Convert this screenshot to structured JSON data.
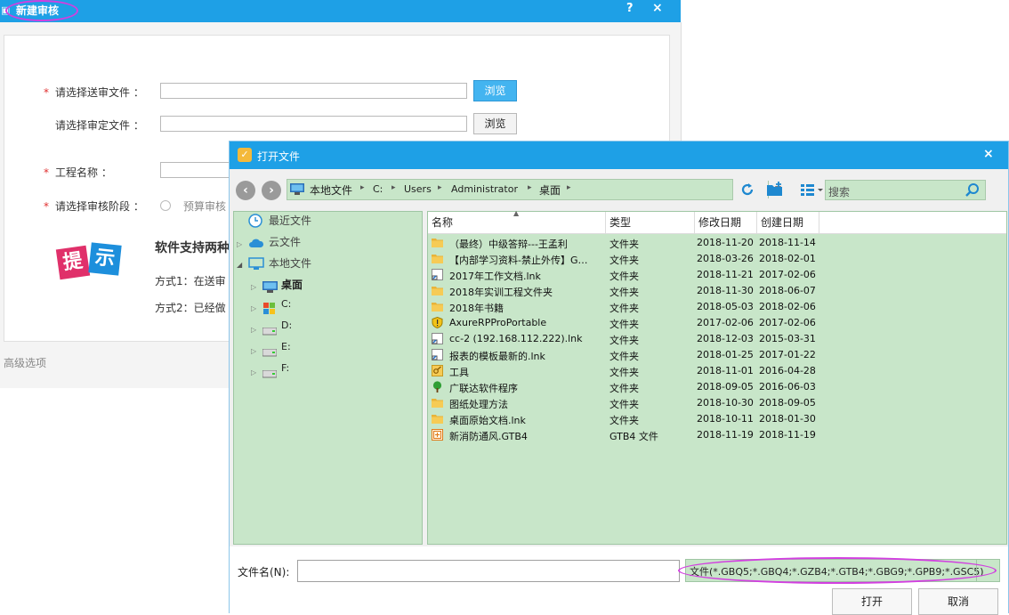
{
  "bg_window": {
    "title": "新建审核",
    "help": "?",
    "close": "×",
    "form": {
      "required_mark": "*",
      "send_file_label": "请选择送审文件 ：",
      "approve_file_label": "请选择审定文件 ：",
      "project_name_label": "工程名称 ：",
      "stage_label": "请选择审核阶段 ：",
      "stage_option": "预算审核",
      "browse_label": "浏览"
    },
    "tip": {
      "logo_chars": [
        "提",
        "示"
      ],
      "title": "软件支持两种",
      "way1": "方式1：在送审",
      "way2": "方式2：已经做"
    },
    "advanced": "高级选项"
  },
  "dialog": {
    "title": "打开文件",
    "icon": "✓",
    "close": "×",
    "breadcrumb": [
      "本地文件",
      "C:",
      "Users",
      "Administrator",
      "桌面"
    ],
    "search_placeholder": "搜索",
    "tree": {
      "recent": "最近文件",
      "cloud": "云文件",
      "local": "本地文件",
      "desktop": "桌面",
      "drives": [
        "C:",
        "D:",
        "E:",
        "F:"
      ]
    },
    "columns": [
      "名称",
      "类型",
      "修改日期",
      "创建日期"
    ],
    "rows": [
      {
        "name": "（最终）中级答辩---王孟利",
        "type": "文件夹",
        "modified": "2018-11-20",
        "created": "2018-11-14",
        "icon": "folder"
      },
      {
        "name": "【内部学习资料-禁止外传】G…",
        "type": "文件夹",
        "modified": "2018-03-26",
        "created": "2018-02-01",
        "icon": "folder"
      },
      {
        "name": "2017年工作文档.lnk",
        "type": "文件夹",
        "modified": "2018-11-21",
        "created": "2017-02-06",
        "icon": "shortcut"
      },
      {
        "name": "2018年实训工程文件夹",
        "type": "文件夹",
        "modified": "2018-11-30",
        "created": "2018-06-07",
        "icon": "folder"
      },
      {
        "name": "2018年书籍",
        "type": "文件夹",
        "modified": "2018-05-03",
        "created": "2018-02-06",
        "icon": "folder"
      },
      {
        "name": "AxureRPProPortable",
        "type": "文件夹",
        "modified": "2017-02-06",
        "created": "2017-02-06",
        "icon": "shield"
      },
      {
        "name": "cc-2 (192.168.112.222).lnk",
        "type": "文件夹",
        "modified": "2018-12-03",
        "created": "2015-03-31",
        "icon": "shortcut"
      },
      {
        "name": "报表的模板最新的.lnk",
        "type": "文件夹",
        "modified": "2018-01-25",
        "created": "2017-01-22",
        "icon": "shortcut"
      },
      {
        "name": "工具",
        "type": "文件夹",
        "modified": "2018-11-01",
        "created": "2016-04-28",
        "icon": "tool"
      },
      {
        "name": "广联达软件程序",
        "type": "文件夹",
        "modified": "2018-09-05",
        "created": "2016-06-03",
        "icon": "tree"
      },
      {
        "name": "图纸处理方法",
        "type": "文件夹",
        "modified": "2018-10-30",
        "created": "2018-09-05",
        "icon": "folder"
      },
      {
        "name": "桌面原始文档.lnk",
        "type": "文件夹",
        "modified": "2018-10-11",
        "created": "2018-01-30",
        "icon": "folder"
      },
      {
        "name": "新消防通风.GTB4",
        "type": "GTB4 文件",
        "modified": "2018-11-19",
        "created": "2018-11-19",
        "icon": "gtb"
      }
    ],
    "filename_label": "文件名(N):",
    "filename_value": "",
    "filter": "文件(*.GBQ5;*.GBQ4;*.GZB4;*.GTB4;*.GBG9;*.GPB9;*.GSC5)",
    "open_button": "打开",
    "cancel_button": "取消"
  }
}
